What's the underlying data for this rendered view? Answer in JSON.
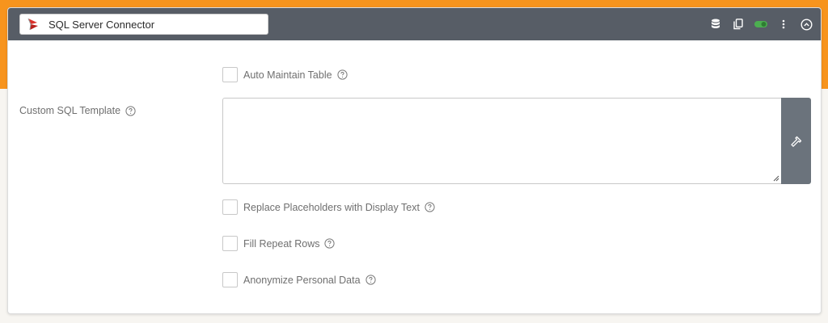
{
  "header": {
    "title": "SQL Server Connector",
    "icons": [
      "database-icon",
      "copy-icon",
      "toggle-on-icon",
      "more-vertical-icon",
      "collapse-up-icon"
    ],
    "toggle_color": "#4caf50"
  },
  "fields": {
    "auto_maintain_label": "Auto Maintain Table",
    "custom_sql_label": "Custom SQL Template",
    "custom_sql_value": "",
    "replace_placeholders_label": "Replace Placeholders with Display Text",
    "fill_repeat_label": "Fill Repeat Rows",
    "anonymize_label": "Anonymize Personal Data"
  },
  "colors": {
    "accent": "#f7941d",
    "header_bg": "#575d66",
    "button_bg": "#6b737c"
  }
}
